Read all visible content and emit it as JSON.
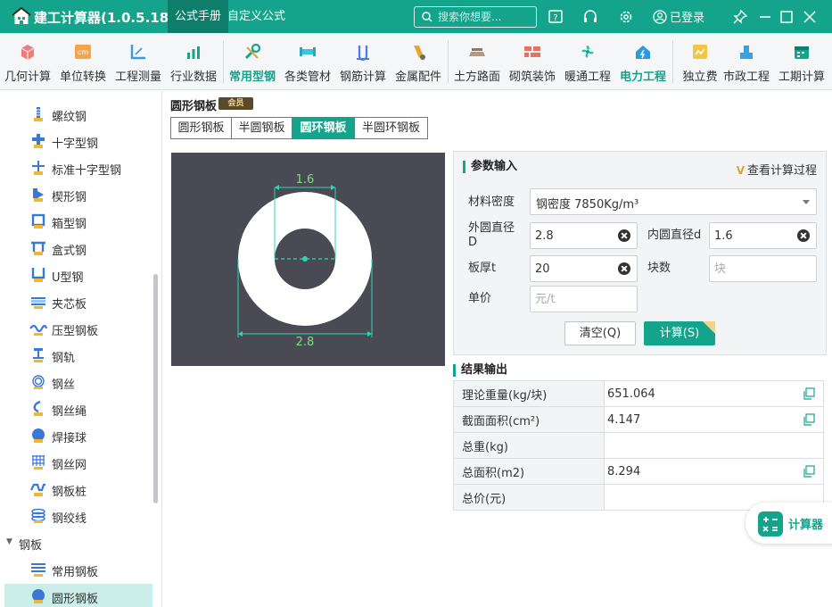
{
  "app": {
    "title": "建工计算器(1.0.5.18)",
    "tabs": [
      "公式手册",
      "自定义公式"
    ],
    "search_placeholder": "搜索你想要...",
    "login": "已登录"
  },
  "toolbar": {
    "items": [
      "几何计算",
      "单位转换",
      "工程测量",
      "行业数据",
      "常用型钢",
      "各类管材",
      "钢筋计算",
      "金属配件",
      "土方路面",
      "砌筑装饰",
      "暖通工程",
      "电力工程",
      "独立费",
      "市政工程",
      "工期计算"
    ]
  },
  "sidebar": {
    "items": [
      "螺纹钢",
      "十字型钢",
      "标准十字型钢",
      "楔形钢",
      "箱型钢",
      "盒式钢",
      "U型钢",
      "夹芯板",
      "压型钢板",
      "钢轨",
      "钢丝",
      "钢丝绳",
      "焊接球",
      "钢丝网",
      "钢板桩",
      "钢绞线"
    ],
    "group": "钢板",
    "group_items": [
      "常用钢板",
      "圆形钢板"
    ]
  },
  "main": {
    "section_title": "圆形钢板",
    "vip_label": "会员",
    "subtabs": [
      "圆形钢板",
      "半圆钢板",
      "圆环钢板",
      "半圆环钢板"
    ],
    "diagram": {
      "inner_label": "1.6",
      "outer_label": "2.8"
    }
  },
  "params": {
    "title": "参数输入",
    "view_process": "查看计算过程",
    "density_label": "材料密度",
    "density_value": "钢密度 7850Kg/m³",
    "outer_label": "外圆直径D",
    "outer_value": "2.8",
    "inner_label": "内圆直径d",
    "inner_value": "1.6",
    "thickness_label": "板厚t",
    "thickness_value": "20",
    "count_label": "块数",
    "count_placeholder": "块",
    "price_label": "单价",
    "price_placeholder": "元/t",
    "clear_btn": "清空(Q)",
    "calc_btn": "计算(S)"
  },
  "results": {
    "title": "结果输出",
    "rows": [
      {
        "label": "理论重量(kg/块)",
        "value": "651.064"
      },
      {
        "label": "截面面积(cm²)",
        "value": "4.147"
      },
      {
        "label": "总重(kg)",
        "value": ""
      },
      {
        "label": "总面积(m2)",
        "value": "8.294"
      },
      {
        "label": "总价(元)",
        "value": ""
      }
    ]
  },
  "float_button": "计算器",
  "colors": {
    "brand": "#14a38b",
    "diagram_bg": "#4a4a54",
    "dimension": "#2bd6b4",
    "dimension_text": "#7be07b"
  }
}
